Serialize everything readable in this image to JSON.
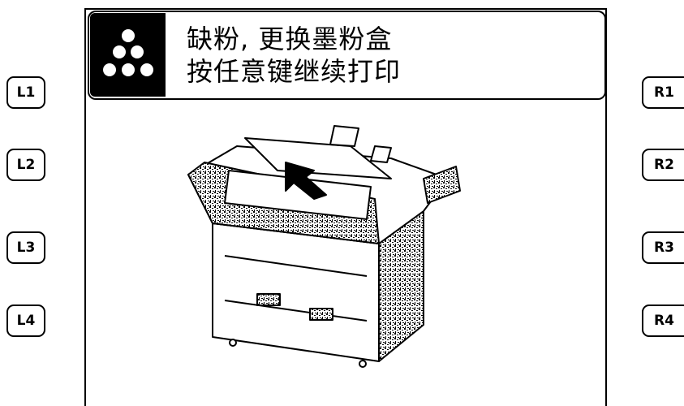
{
  "message": {
    "line1": "缺粉, 更换墨粉盒",
    "line2": "按任意键继续打印",
    "icon": "toner-dots-icon"
  },
  "keys": {
    "left": [
      "L1",
      "L2",
      "L3",
      "L4"
    ],
    "right": [
      "R1",
      "R2",
      "R3",
      "R4"
    ]
  },
  "illustration": "printer-open-toner-illustration"
}
